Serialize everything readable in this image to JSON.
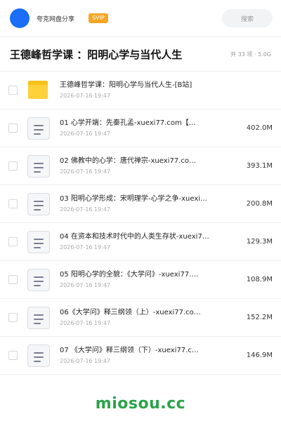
{
  "header": {
    "brand": "夸克网盘分享",
    "vip_badge": "SVIP",
    "search_placeholder": "搜索"
  },
  "folder": {
    "title": "王德峰哲学课 ：阳明心学与当代人生",
    "count": "共 33 项 · 5.0G"
  },
  "files": [
    {
      "type": "folder",
      "name": "王德峰哲学课：阳明心学与当代人生-[B站]",
      "date": "2026-07-16 19:47",
      "size": ""
    },
    {
      "type": "file",
      "name": "01 心学开端：先秦孔孟-xuexi77.com【…",
      "date": "2026-07-16 19:47",
      "size": "402.0M"
    },
    {
      "type": "file",
      "name": "02 佛教中的心学：唐代禅宗-xuexi77.co…",
      "date": "2026-07-16 19:47",
      "size": "393.1M"
    },
    {
      "type": "file",
      "name": "03 阳明心学形成：宋明理学-心学之争-xuexi…",
      "date": "2026-07-16 19:47",
      "size": "200.8M"
    },
    {
      "type": "file",
      "name": "04 在资本和技术时代中的人类生存状-xuexi7…",
      "date": "2026-07-16 19:47",
      "size": "129.3M"
    },
    {
      "type": "file",
      "name": "05 阳明心学的全貌：《大学问》-xuexi77.…",
      "date": "2026-07-16 19:47",
      "size": "108.9M"
    },
    {
      "type": "file",
      "name": "06《大学问》释三纲领（上）-xuexi77.co…",
      "date": "2026-07-16 19:47",
      "size": "152.2M"
    },
    {
      "type": "file",
      "name": "07 《大学问》释三纲领（下）-xuexi77.c…",
      "date": "2026-07-16 19:47",
      "size": "146.9M"
    }
  ],
  "watermark": "miosou.cc",
  "colors": {
    "accent": "#1a6ef7",
    "vip": "#f6a623",
    "folder": "#fcd13a",
    "watermark": "#2ca24a"
  }
}
